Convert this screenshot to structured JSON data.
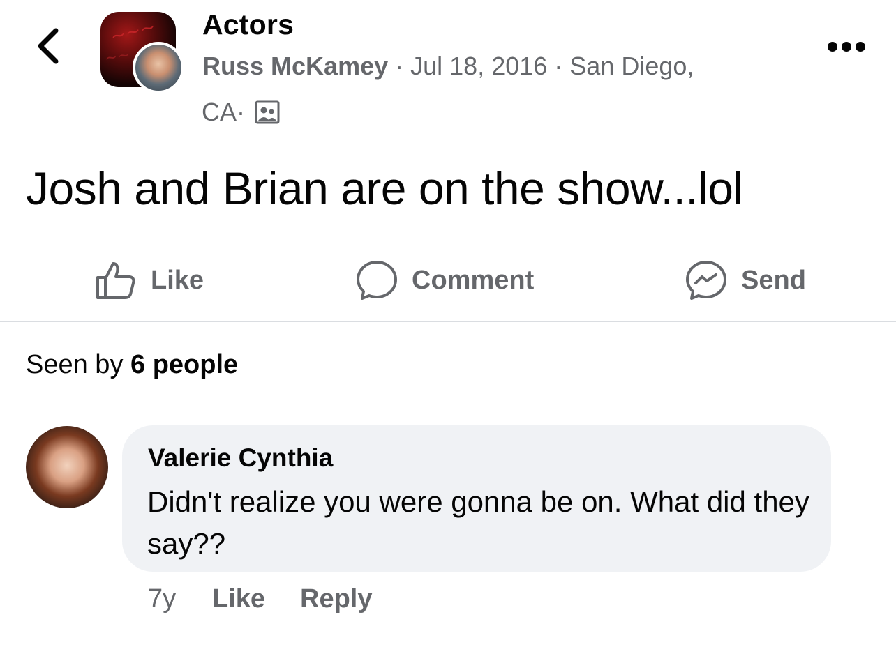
{
  "header": {
    "back_icon": "chevron-left-icon",
    "group_name": "Actors",
    "author": "Russ McKamey",
    "separator": " · ",
    "date": "Jul 18, 2016",
    "location_line1": "San Diego,",
    "location_line2": "CA",
    "privacy_icon": "group-members-icon",
    "more_icon": "more-horizontal-icon"
  },
  "post": {
    "text": "Josh and Brian are on the show...lol"
  },
  "actions": {
    "like": "Like",
    "comment": "Comment",
    "send": "Send"
  },
  "seen": {
    "prefix": "Seen by ",
    "count": "6 people"
  },
  "comment": {
    "author": "Valerie Cynthia",
    "text": "Didn't realize you were gonna be on. What did they say??",
    "age": "7y",
    "like": "Like",
    "reply": "Reply"
  },
  "colors": {
    "secondary_text": "#65676b",
    "primary_text": "#050505",
    "bubble_bg": "#f0f2f5",
    "divider": "#dadde1"
  }
}
